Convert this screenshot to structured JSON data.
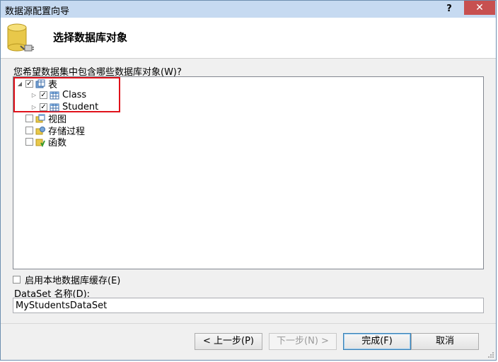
{
  "window": {
    "title": "数据源配置向导",
    "help": "?",
    "close": "✕"
  },
  "header": {
    "title": "选择数据库对象",
    "icon": "database-connector-icon"
  },
  "question": "您希望数据集中包含哪些数据库对象(W)?",
  "tree": {
    "tables": {
      "label": "表",
      "checked": true,
      "expanded": true,
      "children": [
        {
          "label": "Class",
          "checked": true
        },
        {
          "label": "Student",
          "checked": true
        }
      ]
    },
    "views": {
      "label": "视图",
      "checked": false
    },
    "procs": {
      "label": "存储过程",
      "checked": false
    },
    "functions": {
      "label": "函数",
      "checked": false
    }
  },
  "local_cache": {
    "label": "启用本地数据库缓存(E)",
    "checked": false
  },
  "dataset": {
    "label": "DataSet 名称(D):",
    "value": "MyStudentsDataSet"
  },
  "buttons": {
    "prev": "< 上一步(P)",
    "next": "下一步(N) >",
    "finish": "完成(F)",
    "cancel": "取消"
  },
  "colors": {
    "highlight": "#e0121b",
    "titlebar": "#c6daf1",
    "close": "#c75050"
  }
}
